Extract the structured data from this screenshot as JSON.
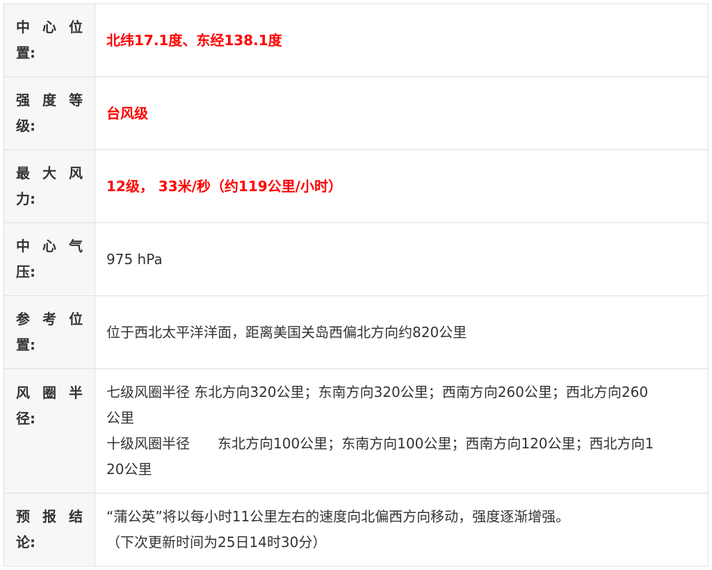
{
  "accent_color": "#ff0000",
  "rows": [
    {
      "label_chars": [
        "中",
        "心",
        "位"
      ],
      "label_rest": "置:",
      "lines": [
        "北纬17.1度、东经138.1度"
      ],
      "highlight": true
    },
    {
      "label_chars": [
        "强",
        "度",
        "等"
      ],
      "label_rest": "级:",
      "lines": [
        "台风级"
      ],
      "highlight": true
    },
    {
      "label_chars": [
        "最",
        "大",
        "风"
      ],
      "label_rest": "力:",
      "lines": [
        "12级， 33米/秒（约119公里/小时）"
      ],
      "highlight": true
    },
    {
      "label_chars": [
        "中",
        "心",
        "气"
      ],
      "label_rest": "压:",
      "lines": [
        "975 hPa"
      ],
      "highlight": false
    },
    {
      "label_chars": [
        "参",
        "考",
        "位"
      ],
      "label_rest": "置:",
      "lines": [
        "位于西北太平洋洋面，距离美国关岛西偏北方向约820公里"
      ],
      "highlight": false
    },
    {
      "label_chars": [
        "风",
        "圈",
        "半"
      ],
      "label_rest": "径:",
      "lines": [
        "七级风圈半径 东北方向320公里；东南方向320公里；西南方向260公里；西北方向260",
        "公里",
        "十级风圈半径　　东北方向100公里；东南方向100公里；西南方向120公里；西北方向1",
        "20公里"
      ],
      "highlight": false
    },
    {
      "label_chars": [
        "预",
        "报",
        "结"
      ],
      "label_rest": "论:",
      "lines": [
        "“蒲公英”将以每小时11公里左右的速度向北偏西方向移动，强度逐渐增强。",
        "（下次更新时间为25日14时30分）"
      ],
      "highlight": false
    }
  ]
}
